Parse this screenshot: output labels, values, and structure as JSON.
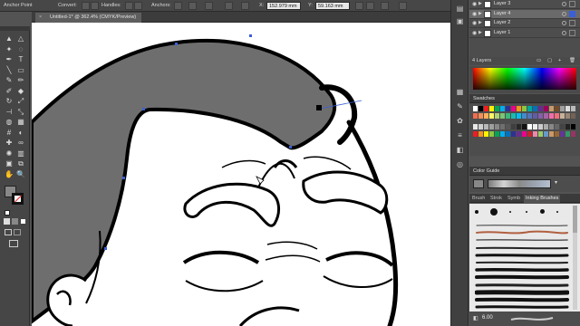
{
  "control_bar": {
    "anchor_point_label": "Anchor Point",
    "convert_label": "Convert:",
    "handles_label": "Handles:",
    "anchors_label": "Anchors:",
    "x_label": "X:",
    "x_value": "152.979 mm",
    "y_label": "Y:",
    "y_value": "59.163 mm"
  },
  "document": {
    "tab_title": "Untitled-1* @ 362.4% (CMYK/Preview)",
    "close_glyph": "×"
  },
  "toolbar": {
    "tools": [
      "selection-tool",
      "direct-selection-tool",
      "magic-wand-tool",
      "lasso-tool",
      "pen-tool",
      "type-tool",
      "line-segment-tool",
      "rectangle-tool",
      "paintbrush-tool",
      "pencil-tool",
      "blob-brush-tool",
      "eraser-tool",
      "rotate-tool",
      "scale-tool",
      "width-tool",
      "free-transform-tool",
      "shape-builder-tool",
      "perspective-grid-tool",
      "mesh-tool",
      "gradient-tool",
      "eyedropper-tool",
      "blend-tool",
      "symbol-sprayer-tool",
      "column-graph-tool",
      "artboard-tool",
      "slice-tool",
      "hand-tool",
      "zoom-tool"
    ]
  },
  "layers": {
    "items": [
      {
        "label": "Layer 3",
        "selected": false
      },
      {
        "label": "Layer 4",
        "selected": true
      },
      {
        "label": "Layer 2",
        "selected": false
      },
      {
        "label": "Layer 1",
        "selected": false
      }
    ],
    "count_label": "4 Layers"
  },
  "swatches": {
    "title": "Swatches"
  },
  "color_guide": {
    "title": "Color Guide"
  },
  "brushes": {
    "tabs": [
      "Brush",
      "Strok",
      "Symb",
      "Inking Brushes"
    ],
    "active_tab": "Inking Brushes",
    "size_value": "6.00"
  },
  "colors": {
    "canvas": "#ffffff",
    "hair": "#6e6e6e",
    "ui_dark": "#474747",
    "selection": "#3a5fd6"
  }
}
